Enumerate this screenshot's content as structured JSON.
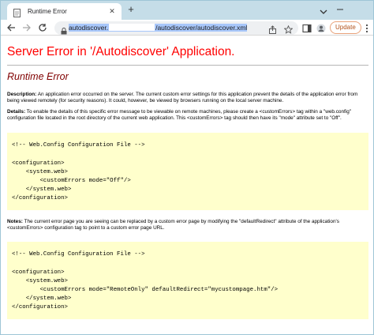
{
  "tab": {
    "title": "Runtime Error",
    "close": "✕",
    "new_tab": "+"
  },
  "toolbar": {
    "url_before": "autodiscover.",
    "url_after": "/autodiscover/autodiscover.xml",
    "update_label": "Update"
  },
  "page": {
    "h1": "Server Error in '/Autodiscover' Application.",
    "h2": "Runtime Error",
    "description_label": "Description:",
    "description_text": "An application error occurred on the server. The current custom error settings for this application prevent the details of the application error from being viewed remotely (for security reasons). It could, however, be viewed by browsers running on the local server machine.",
    "details_label": "Details:",
    "details_text": "To enable the details of this specific error message to be viewable on remote machines, please create a <customErrors> tag within a \"web.config\" configuration file located in the root directory of the current web application. This <customErrors> tag should then have its \"mode\" attribute set to \"Off\".",
    "code1": "\n<!-- Web.Config Configuration File -->\n\n<configuration>\n    <system.web>\n        <customErrors mode=\"Off\"/>\n    </system.web>\n</configuration>",
    "notes_label": "Notes:",
    "notes_text": "The current error page you are seeing can be replaced by a custom error page by modifying the \"defaultRedirect\" attribute of the application's <customErrors> configuration tag to point to a custom error page URL.",
    "code2": "\n<!-- Web.Config Configuration File -->\n\n<configuration>\n    <system.web>\n        <customErrors mode=\"RemoteOnly\" defaultRedirect=\"mycustompage.htm\"/>\n    </system.web>\n</configuration>"
  },
  "colors": {
    "accent": "#c5dde8",
    "error_heading": "#ff0000",
    "subheading": "#800000",
    "code_bg": "#ffffcc",
    "update": "#b3541e"
  }
}
